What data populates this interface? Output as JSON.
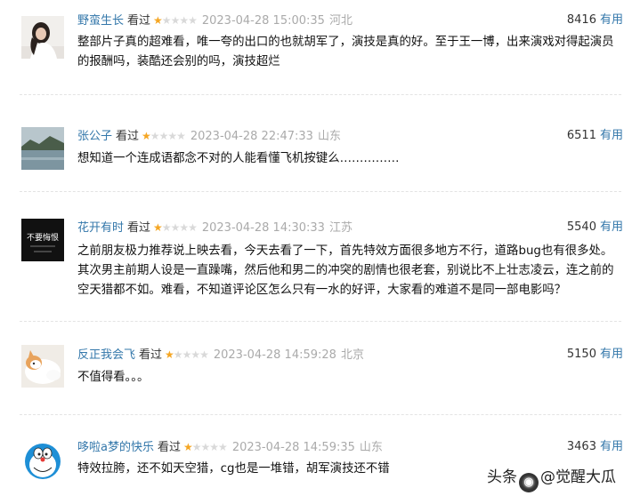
{
  "reviews": [
    {
      "user": "野蛮生长",
      "action": "看过",
      "rating": 1,
      "time": "2023-04-28 15:00:35",
      "location": "河北",
      "votes": "8416",
      "useful_label": "有用",
      "avatar_icon": "woman-portrait-avatar",
      "content": "整部片子真的超难看，唯一夸的出口的也就胡军了，演技是真的好。至于王一博，出来演戏对得起演员的报酬吗，装酷还会别的吗，演技超烂"
    },
    {
      "user": "张公子",
      "action": "看过",
      "rating": 1,
      "time": "2023-04-28 22:47:33",
      "location": "山东",
      "votes": "6511",
      "useful_label": "有用",
      "avatar_icon": "landscape-avatar",
      "content": "想知道一个连成语都念不对的人能看懂飞机按键么……………"
    },
    {
      "user": "花开有时",
      "action": "看过",
      "rating": 1,
      "time": "2023-04-28 14:30:33",
      "location": "江苏",
      "votes": "5540",
      "useful_label": "有用",
      "avatar_icon": "text-sign-avatar",
      "avatar_text": "不要悔恨",
      "content": "之前朋友极力推荐说上映去看，今天去看了一下，首先特效方面很多地方不行，道路bug也有很多处。其次男主前期人设是一直躁嘴，然后他和男二的冲突的剧情也很老套，别说比不上壮志凌云，连之前的空天猎都不如。难看，不知道评论区怎么只有一水的好评，大家看的难道不是同一部电影吗？"
    },
    {
      "user": "反正我会飞",
      "action": "看过",
      "rating": 1,
      "time": "2023-04-28 14:59:28",
      "location": "北京",
      "votes": "5150",
      "useful_label": "有用",
      "avatar_icon": "cat-avatar",
      "content": "不值得看。。。"
    },
    {
      "user": "哆啦a梦的快乐",
      "action": "看过",
      "rating": 1,
      "time": "2023-04-28 14:59:35",
      "location": "山东",
      "votes": "3463",
      "useful_label": "有用",
      "avatar_icon": "doraemon-avatar",
      "content": "特效拉胯，还不如天空猎，cg也是一堆错，胡军演技还不错"
    }
  ],
  "stars_total": 5,
  "watermark": {
    "prefix": "头条",
    "handle": "@觉醒大瓜"
  },
  "colors": {
    "link": "#3377aa",
    "star_on": "#f5a623",
    "star_off": "#d9d9d9",
    "muted": "#aaaaaa"
  }
}
